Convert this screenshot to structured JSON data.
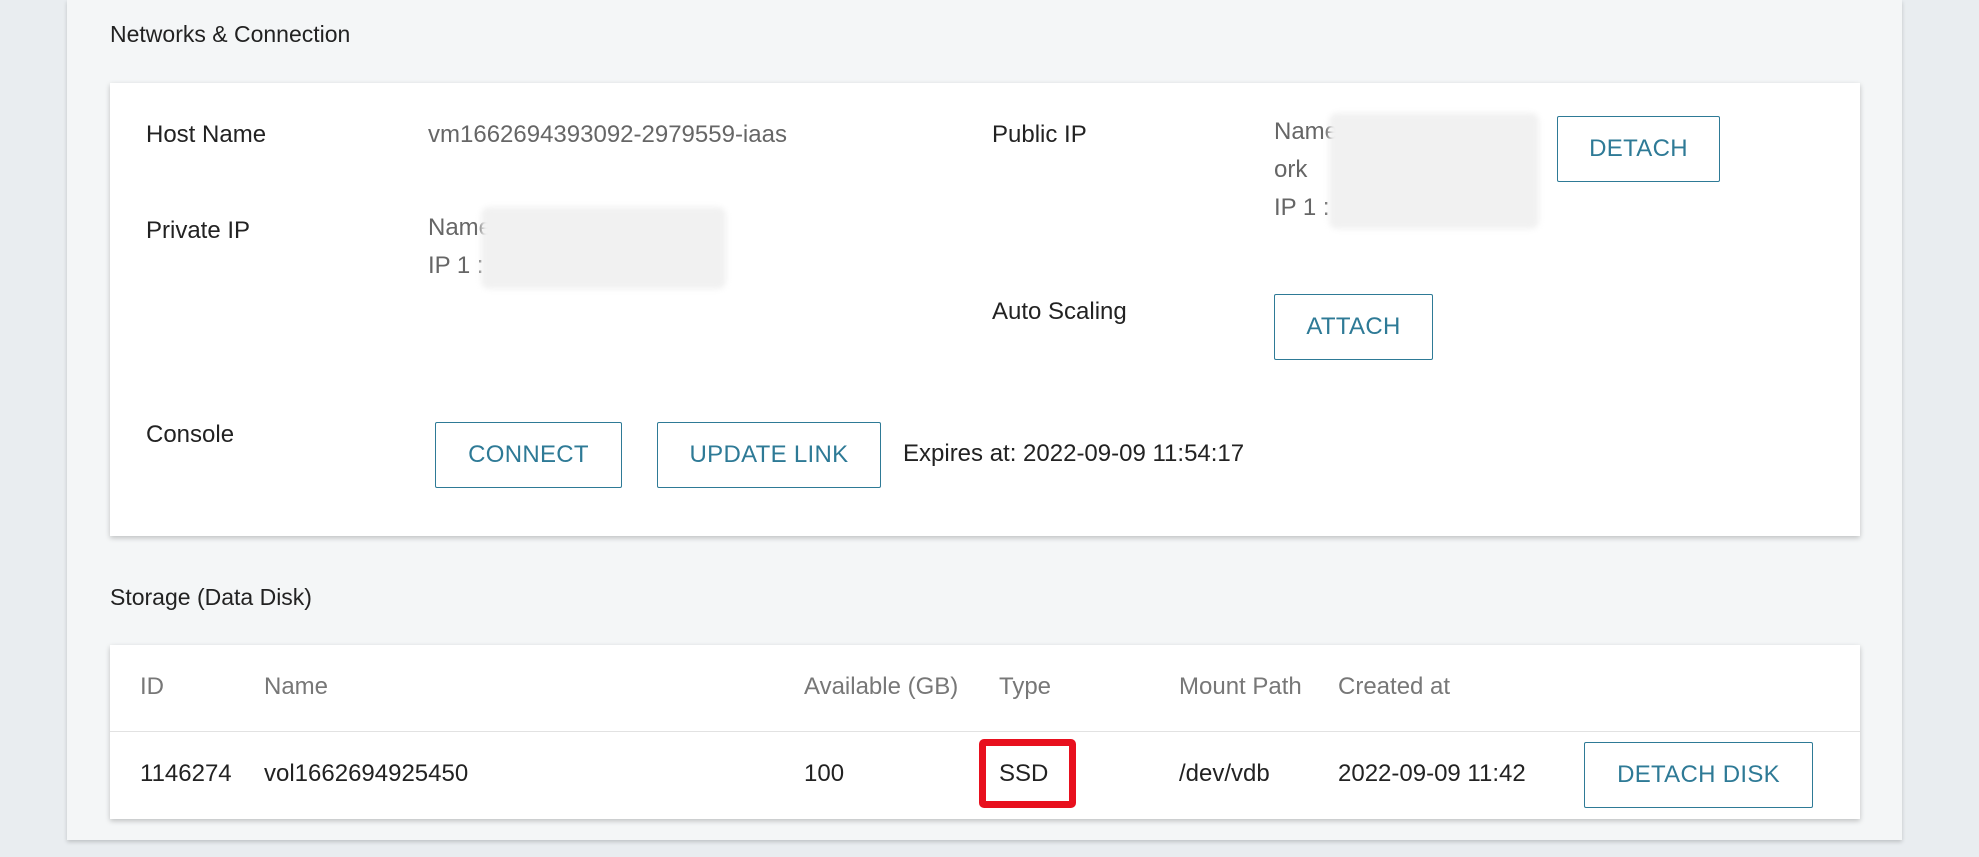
{
  "networks": {
    "title": "Networks & Connection",
    "host_name_label": "Host Name",
    "host_name_value": "vm1662694393092-2979559-iaas",
    "private_ip_label": "Private IP",
    "private_ip_name": "Name",
    "private_ip_ip": "IP 1 :",
    "public_ip_label": "Public IP",
    "public_ip_name": "Name",
    "public_ip_network": "ork",
    "public_ip_ip": "IP 1 :",
    "detach_button": "DETACH",
    "auto_scaling_label": "Auto Scaling",
    "attach_button": "ATTACH",
    "console_label": "Console",
    "connect_button": "CONNECT",
    "update_link_button": "UPDATE LINK",
    "expires_text": "Expires at: 2022-09-09 11:54:17"
  },
  "storage": {
    "title": "Storage (Data Disk)",
    "columns": [
      "ID",
      "Name",
      "Available (GB)",
      "Type",
      "Mount Path",
      "Created at"
    ],
    "rows": [
      {
        "id": "1146274",
        "name": "vol1662694925450",
        "available": "100",
        "type": "SSD",
        "mount_path": "/dev/vdb",
        "created_at": "2022-09-09 11:42",
        "action": "DETACH DISK"
      }
    ]
  },
  "colors": {
    "accent": "#2e7a96",
    "highlight": "#e8101e"
  }
}
